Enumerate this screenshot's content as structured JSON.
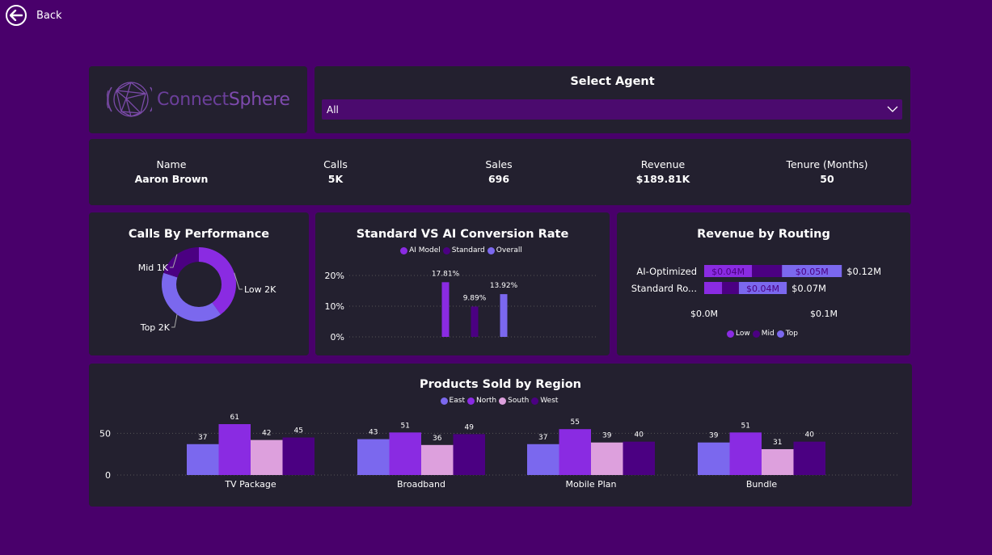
{
  "back": {
    "label": "Back"
  },
  "logo": {
    "text_a": "Connect",
    "text_b": "Sphere"
  },
  "agent_select": {
    "title": "Select Agent",
    "value": "All"
  },
  "kpis": [
    {
      "label": "Name",
      "value": "Aaron Brown"
    },
    {
      "label": "Calls",
      "value": "5K"
    },
    {
      "label": "Sales",
      "value": "696"
    },
    {
      "label": "Revenue",
      "value": "$189.81K"
    },
    {
      "label": "Tenure (Months)",
      "value": "50"
    }
  ],
  "colors": {
    "low": "#8a2be2",
    "mid": "#4b0082",
    "top": "#7b68ee",
    "east": "#7b68ee",
    "north": "#8a2be2",
    "south": "#dda0dd",
    "west": "#4b0082"
  },
  "calls_by_performance": {
    "title": "Calls By Performance",
    "chart_data": {
      "type": "pie",
      "labels": [
        "Low 2K",
        "Top 2K",
        "Mid 1K"
      ],
      "values": [
        2,
        2,
        1
      ],
      "colors": [
        "#8a2be2",
        "#7b68ee",
        "#4b0082"
      ]
    }
  },
  "conversion_rate": {
    "title": "Standard VS AI Conversion Rate",
    "legend": [
      "AI Model",
      "Standard",
      "Overall"
    ],
    "chart_data": {
      "type": "bar",
      "categories": [
        "AI Model",
        "Standard",
        "Overall"
      ],
      "values": [
        17.81,
        9.89,
        13.92
      ],
      "labels": [
        "17.81%",
        "9.89%",
        "13.92%"
      ],
      "yticks": [
        "0%",
        "10%",
        "20%"
      ],
      "ylim": [
        0,
        20
      ],
      "colors": [
        "#8a2be2",
        "#4b0082",
        "#7b68ee"
      ]
    }
  },
  "revenue_by_routing": {
    "title": "Revenue by Routing",
    "legend": [
      "Low",
      "Mid",
      "Top"
    ],
    "chart_data": {
      "type": "bar",
      "orientation": "horizontal-stacked",
      "categories": [
        "AI-Optimized",
        "Standard Ro..."
      ],
      "series": [
        {
          "name": "Low",
          "values": [
            0.04,
            0.015
          ],
          "labels": [
            "$0.04M",
            ""
          ]
        },
        {
          "name": "Mid",
          "values": [
            0.025,
            0.014
          ],
          "labels": [
            "",
            ""
          ]
        },
        {
          "name": "Top",
          "values": [
            0.05,
            0.04
          ],
          "labels": [
            "$0.05M",
            "$0.04M"
          ]
        }
      ],
      "totals": [
        "$0.12M",
        "$0.07M"
      ],
      "xticks": [
        "$0.0M",
        "$0.1M"
      ],
      "xlim": [
        0,
        0.1
      ]
    }
  },
  "products_by_region": {
    "title": "Products Sold by Region",
    "legend": [
      "East",
      "North",
      "South",
      "West"
    ],
    "chart_data": {
      "type": "bar",
      "categories": [
        "TV Package",
        "Broadband",
        "Mobile Plan",
        "Bundle"
      ],
      "series": [
        {
          "name": "East",
          "values": [
            37,
            43,
            37,
            39
          ]
        },
        {
          "name": "North",
          "values": [
            61,
            51,
            55,
            51
          ]
        },
        {
          "name": "South",
          "values": [
            42,
            36,
            39,
            31
          ]
        },
        {
          "name": "West",
          "values": [
            45,
            49,
            40,
            40
          ]
        }
      ],
      "yticks": [
        "0",
        "50"
      ],
      "ylim": [
        0,
        61
      ]
    }
  }
}
